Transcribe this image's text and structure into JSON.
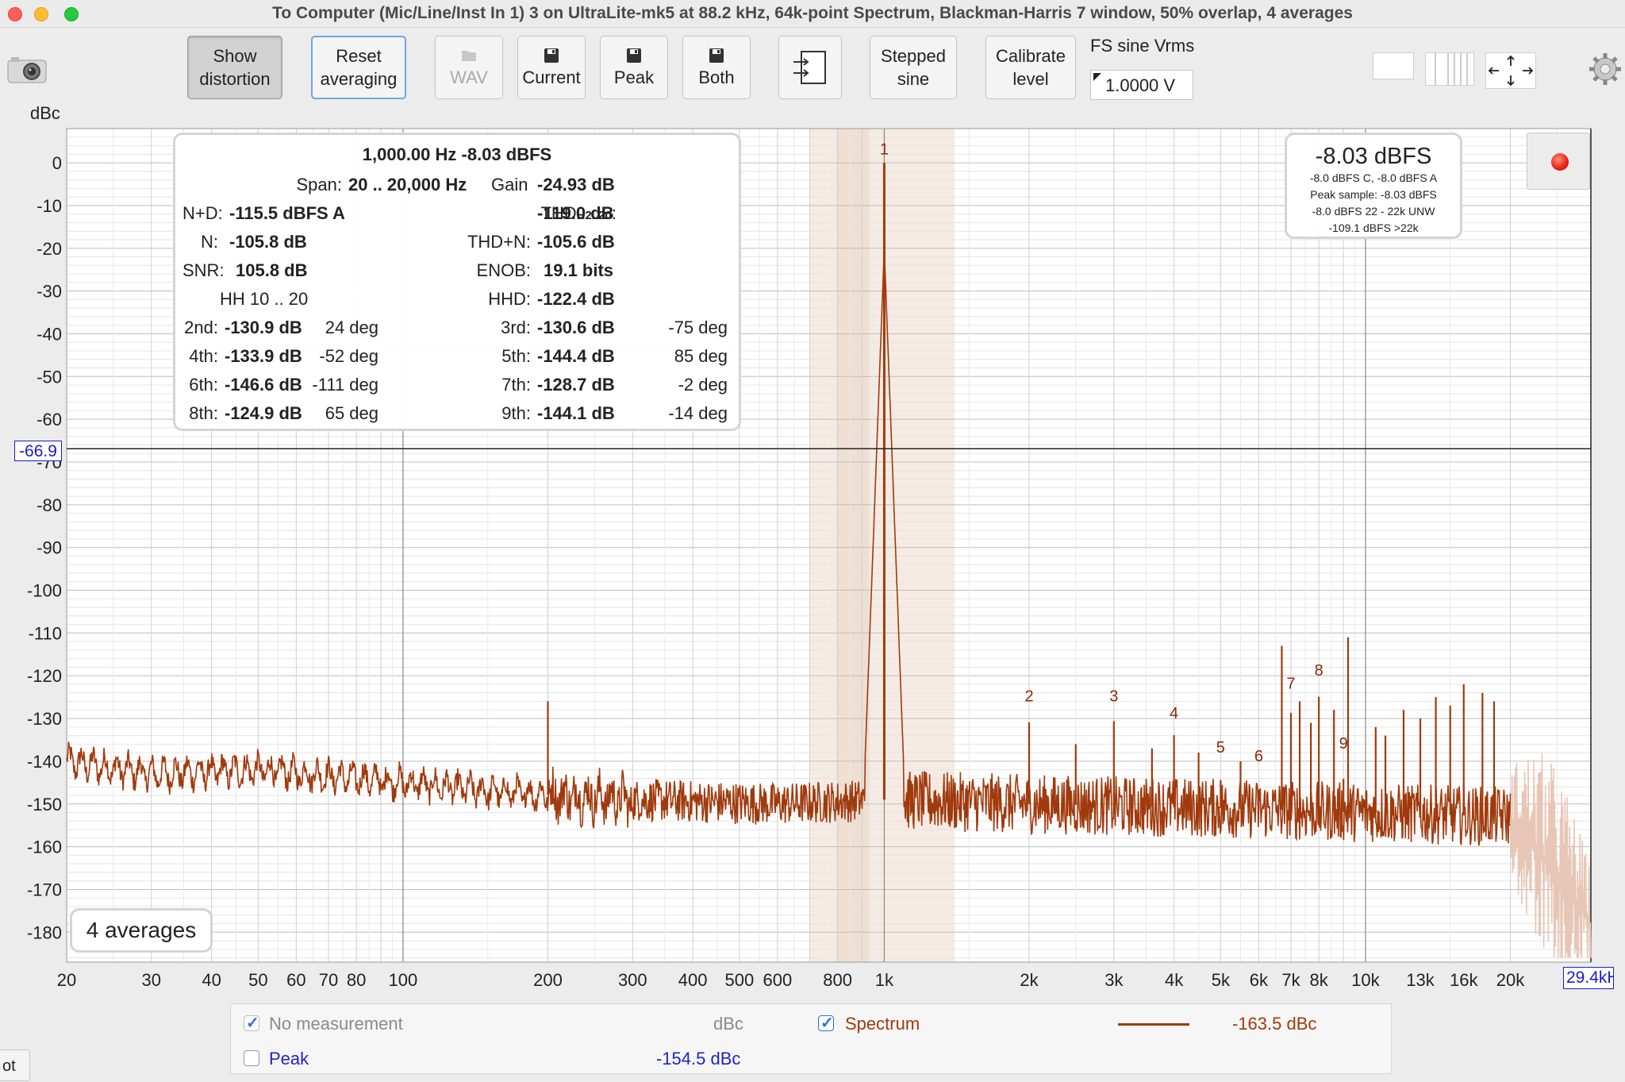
{
  "window": {
    "title": "To Computer (Mic/Line/Inst In 1) 3 on UltraLite-mk5 at 88.2 kHz, 64k-point Spectrum, Blackman-Harris 7 window, 50% overlap, 4 averages"
  },
  "toolbar": {
    "show_distortion": [
      "Show",
      "distortion"
    ],
    "reset_averaging": [
      "Reset",
      "averaging"
    ],
    "wav": "WAV",
    "current": "Current",
    "peak": "Peak",
    "both": "Both",
    "stepped_sine": [
      "Stepped",
      "sine"
    ],
    "calibrate_level": [
      "Calibrate",
      "level"
    ],
    "fs_label": "FS sine Vrms",
    "fs_value": "1.0000 V"
  },
  "icons": [
    "camera-icon",
    "save-icon",
    "folder-icon",
    "import-icon",
    "layout-single-icon",
    "layout-columns-icon",
    "fit-arrows-icon",
    "gear-icon",
    "record-icon"
  ],
  "info_box": {
    "header": "1,000.00 Hz  -8.03 dBFS",
    "span_label": "Span:",
    "span_value": "20 .. 20,000 Hz",
    "gain_label": "Gain",
    "gain_value": "-24.93 dB",
    "nd_label": "N+D:",
    "nd_value": "-115.5 dBFS A",
    "thd_label": "THD",
    "thd_sub": "H2..20",
    "thd_value": "-119.0 dB",
    "n_label": "N:",
    "n_value": "-105.8 dB",
    "thdn_label": "THD+N:",
    "thdn_value": "-105.6 dB",
    "snr_label": "SNR:",
    "snr_value": "105.8 dB",
    "enob_label": "ENOB:",
    "enob_value": "19.1 bits",
    "hh_label": "HH 10 .. 20",
    "hhd_label": "HHD:",
    "hhd_value": "-122.4 dB",
    "harmonics": [
      {
        "label": "2nd:",
        "value": "-130.9 dB",
        "phase": "24 deg",
        "label2": "3rd:",
        "value2": "-130.6 dB",
        "phase2": "-75 deg"
      },
      {
        "label": "4th:",
        "value": "-133.9 dB",
        "phase": "-52 deg",
        "label2": "5th:",
        "value2": "-144.4 dB",
        "phase2": "85 deg"
      },
      {
        "label": "6th:",
        "value": "-146.6 dB",
        "phase": "-111 deg",
        "label2": "7th:",
        "value2": "-128.7 dB",
        "phase2": "-2 deg"
      },
      {
        "label": "8th:",
        "value": "-124.9 dB",
        "phase": "65 deg",
        "label2": "9th:",
        "value2": "-144.1 dB",
        "phase2": "-14 deg"
      }
    ]
  },
  "level_box": {
    "main": "-8.03 dBFS",
    "lines": [
      "-8.0 dBFS C, -8.0 dBFS A",
      "Peak sample: -8.03 dBFS",
      "-8.0 dBFS 22 - 22k UNW",
      "-109.1 dBFS >22k"
    ]
  },
  "averages_badge": "4 averages",
  "cursor": {
    "y_value": "-66.9",
    "x_value": "29.4kHz"
  },
  "chart_data": {
    "type": "line",
    "ylabel": "dBc",
    "xscale": "log",
    "xlim": [
      20,
      29400
    ],
    "ylim": [
      -187,
      8
    ],
    "yticks": [
      0,
      -10,
      -20,
      -30,
      -40,
      -50,
      -60,
      -70,
      -80,
      -90,
      -100,
      -110,
      -120,
      -130,
      -140,
      -150,
      -160,
      -170,
      -180
    ],
    "xticks": [
      {
        "v": 20,
        "label": "20"
      },
      {
        "v": 30,
        "label": "30"
      },
      {
        "v": 40,
        "label": "40"
      },
      {
        "v": 50,
        "label": "50"
      },
      {
        "v": 60,
        "label": "60"
      },
      {
        "v": 70,
        "label": "70"
      },
      {
        "v": 80,
        "label": "80"
      },
      {
        "v": 100,
        "label": "100"
      },
      {
        "v": 200,
        "label": "200"
      },
      {
        "v": 300,
        "label": "300"
      },
      {
        "v": 400,
        "label": "400"
      },
      {
        "v": 500,
        "label": "500"
      },
      {
        "v": 600,
        "label": "600"
      },
      {
        "v": 800,
        "label": "800"
      },
      {
        "v": 1000,
        "label": "1k"
      },
      {
        "v": 2000,
        "label": "2k"
      },
      {
        "v": 3000,
        "label": "3k"
      },
      {
        "v": 4000,
        "label": "4k"
      },
      {
        "v": 5000,
        "label": "5k"
      },
      {
        "v": 6000,
        "label": "6k"
      },
      {
        "v": 7000,
        "label": "7k"
      },
      {
        "v": 8000,
        "label": "8k"
      },
      {
        "v": 10000,
        "label": "10k"
      },
      {
        "v": 13000,
        "label": "13k"
      },
      {
        "v": 16000,
        "label": "16k"
      },
      {
        "v": 20000,
        "label": "20k"
      }
    ],
    "highlight_band_hz": [
      700,
      1400
    ],
    "cursor_hz": 29400,
    "cursor_db": -66.9,
    "series": [
      {
        "color": "#a03a0c",
        "baseline_points": [
          [
            20,
            -140
          ],
          [
            30,
            -143
          ],
          [
            50,
            -142
          ],
          [
            80,
            -144
          ],
          [
            100,
            -145
          ],
          [
            150,
            -147
          ],
          [
            300,
            -149
          ],
          [
            600,
            -150
          ],
          [
            1000,
            -149
          ],
          [
            2000,
            -150
          ],
          [
            5000,
            -151
          ],
          [
            10000,
            -152
          ],
          [
            20000,
            -153
          ]
        ],
        "fundamental": {
          "hz": 1000,
          "db": 0
        },
        "spurs": [
          {
            "hz": 200,
            "db": -126
          },
          {
            "hz": 2000,
            "db": -130.9
          },
          {
            "hz": 3000,
            "db": -130.6
          },
          {
            "hz": 4000,
            "db": -133.9
          },
          {
            "hz": 5000,
            "db": -144.4
          },
          {
            "hz": 6000,
            "db": -146.6
          },
          {
            "hz": 7000,
            "db": -128.7
          },
          {
            "hz": 8000,
            "db": -124.9
          },
          {
            "hz": 9000,
            "db": -144.1
          },
          {
            "hz": 6700,
            "db": -113
          },
          {
            "hz": 9200,
            "db": -111
          },
          {
            "hz": 7300,
            "db": -126
          },
          {
            "hz": 7700,
            "db": -131
          },
          {
            "hz": 8600,
            "db": -128
          },
          {
            "hz": 10500,
            "db": -132
          },
          {
            "hz": 12000,
            "db": -128
          },
          {
            "hz": 14000,
            "db": -125
          },
          {
            "hz": 15000,
            "db": -127
          },
          {
            "hz": 16000,
            "db": -122
          },
          {
            "hz": 17500,
            "db": -124
          },
          {
            "hz": 18500,
            "db": -126
          },
          {
            "hz": 2500,
            "db": -136
          },
          {
            "hz": 3600,
            "db": -137
          },
          {
            "hz": 4500,
            "db": -138
          },
          {
            "hz": 5500,
            "db": -140
          },
          {
            "hz": 11000,
            "db": -134
          },
          {
            "hz": 13000,
            "db": -130
          }
        ]
      }
    ],
    "harmonic_labels": [
      {
        "n": "1",
        "hz": 1000,
        "db": 2
      },
      {
        "n": "2",
        "hz": 2000,
        "db": -126
      },
      {
        "n": "3",
        "hz": 3000,
        "db": -126
      },
      {
        "n": "4",
        "hz": 4000,
        "db": -130
      },
      {
        "n": "5",
        "hz": 5000,
        "db": -138
      },
      {
        "n": "6",
        "hz": 6000,
        "db": -140
      },
      {
        "n": "7",
        "hz": 7000,
        "db": -123
      },
      {
        "n": "8",
        "hz": 8000,
        "db": -120
      },
      {
        "n": "9",
        "hz": 9000,
        "db": -137
      }
    ]
  },
  "legend": {
    "no_measurement": "No measurement",
    "unit": "dBc",
    "spectrum": "Spectrum",
    "spectrum_value": "-163.5 dBc",
    "spectrum_color": "#a03a0c",
    "peak": "Peak",
    "peak_value": "-154.5 dBc",
    "peak_color": "#2222cc"
  },
  "left_tab": "ot"
}
